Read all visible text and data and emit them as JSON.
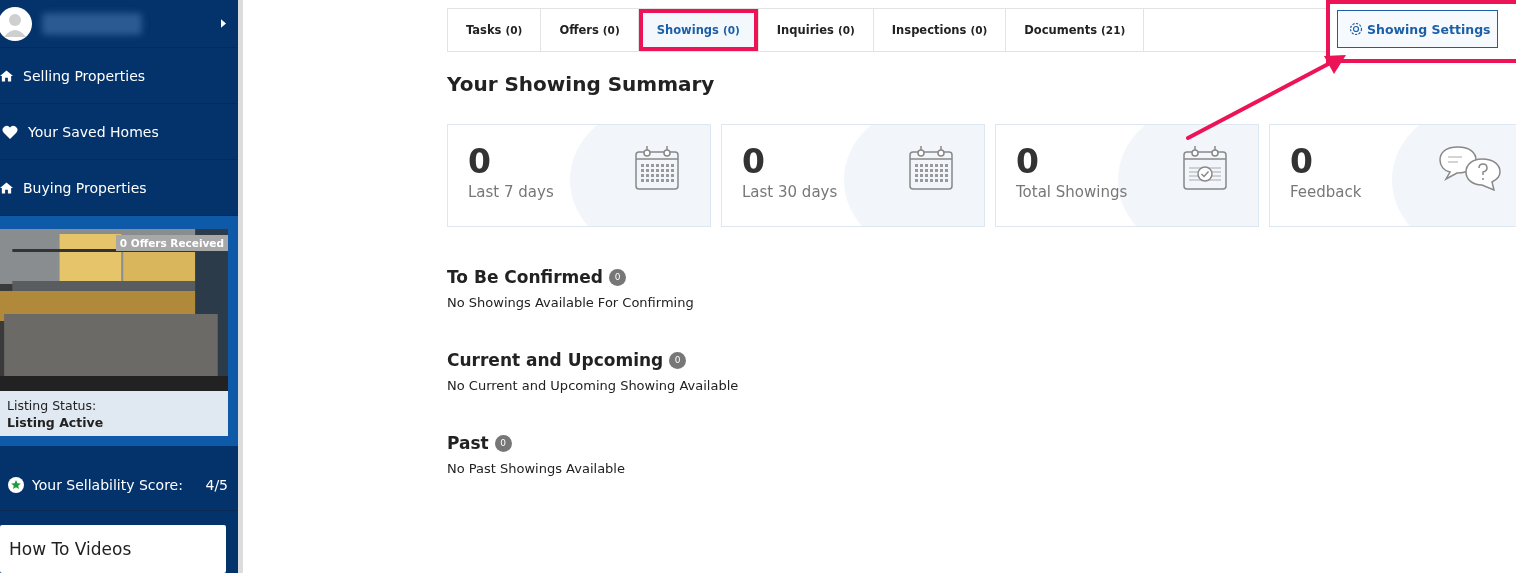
{
  "sidebar": {
    "nav": [
      {
        "kind": "home",
        "label": "Selling Properties"
      },
      {
        "kind": "heart",
        "label": "Your Saved Homes"
      },
      {
        "kind": "home",
        "label": "Buying Properties"
      }
    ],
    "listing": {
      "badge": "0 Offers Received",
      "status_label": "Listing Status:",
      "status": "Listing Active"
    },
    "score": {
      "label": "Your Sellability Score:",
      "value": "4/5"
    },
    "videos": {
      "title": "How To Videos"
    }
  },
  "tabs": [
    {
      "label": "Tasks",
      "count": "(0)",
      "selected": false
    },
    {
      "label": "Offers",
      "count": "(0)",
      "selected": false
    },
    {
      "label": "Showings",
      "count": "(0)",
      "selected": true
    },
    {
      "label": "Inquiries",
      "count": "(0)",
      "selected": false
    },
    {
      "label": "Inspections",
      "count": "(0)",
      "selected": false
    },
    {
      "label": "Documents",
      "count": "(21)",
      "selected": false
    }
  ],
  "settings_button": "Showing Settings",
  "summary_title": "Your Showing Summary",
  "stats": [
    {
      "value": "0",
      "label": "Last 7 days",
      "kind": "calendar"
    },
    {
      "value": "0",
      "label": "Last 30 days",
      "kind": "calendar"
    },
    {
      "value": "0",
      "label": "Total Showings",
      "kind": "calendar-check"
    },
    {
      "value": "0",
      "label": "Feedback",
      "kind": "chat"
    }
  ],
  "sections": [
    {
      "title": "To Be Confirmed",
      "count": "0",
      "empty_text": "No Showings Available For Confirming"
    },
    {
      "title": "Current and Upcoming",
      "count": "0",
      "empty_text": "No Current and Upcoming Showing Available"
    },
    {
      "title": "Past",
      "count": "0",
      "empty_text": "No Past Showings Available"
    }
  ]
}
